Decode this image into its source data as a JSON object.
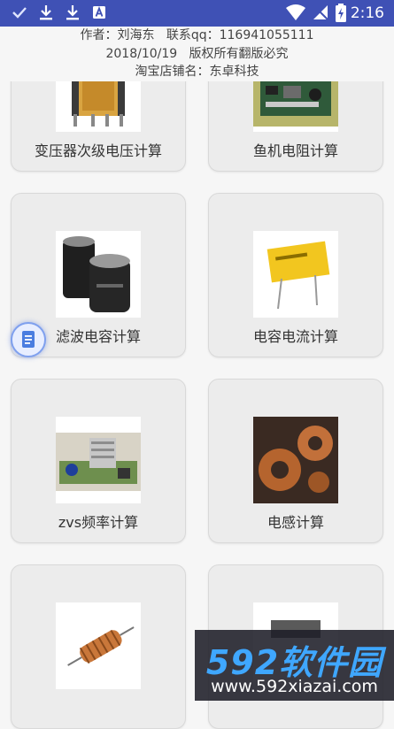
{
  "status_bar": {
    "time": "2:16",
    "icons": [
      "check-icon",
      "download-icon",
      "download-icon",
      "app-notification-icon",
      "wifi-icon",
      "no-sim-icon",
      "battery-icon"
    ],
    "color": "#3f51b5"
  },
  "header": {
    "line1": "作者：刘海东   联系qq：116941055111",
    "line2": "2018/10/19   版权所有翻版必究",
    "line3": "淘宝店铺名：东卓科技"
  },
  "cards": [
    {
      "label": "变压器次级电压计算",
      "image": "transformer-image"
    },
    {
      "label": "鱼机电阻计算",
      "image": "circuit-board-image"
    },
    {
      "label": "滤波电容计算",
      "image": "electrolytic-capacitors-image"
    },
    {
      "label": "电容电流计算",
      "image": "film-capacitor-image"
    },
    {
      "label": "zvs频率计算",
      "image": "zvs-board-image"
    },
    {
      "label": "电感计算",
      "image": "toroid-inductors-image"
    },
    {
      "label": "",
      "image": "copper-coil-image"
    },
    {
      "label": "",
      "image": "component-image"
    }
  ],
  "floating_button": {
    "icon": "document-icon"
  },
  "watermark": {
    "brand": "592软件园",
    "url": "www.592xiazai.com"
  }
}
